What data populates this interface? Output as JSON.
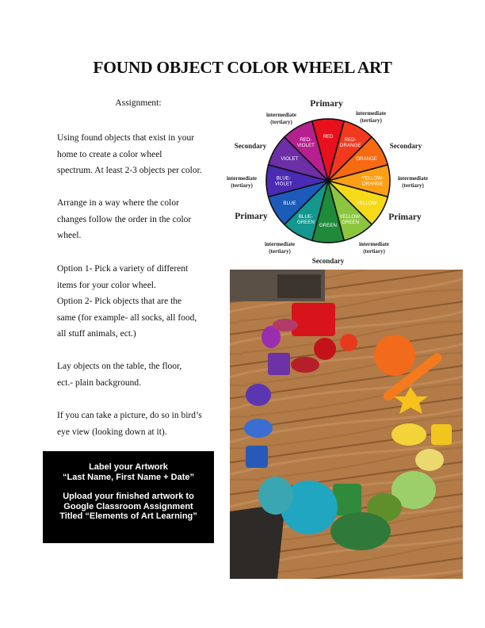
{
  "title": "FOUND OBJECT COLOR WHEEL ART",
  "assignment_heading": "Assignment:",
  "paragraphs": [
    [
      "Using found objects that exist in your",
      "home to create a color wheel",
      "spectrum. At least 2-3 objects per color."
    ],
    [
      "Arrange in a way where the color",
      "changes follow the order in the color",
      "wheel."
    ],
    [
      "Option 1- Pick a variety of different",
      "items for your color wheel.",
      "Option 2-  Pick objects that are the",
      "same (for example- all socks, all food,",
      "all stuff animals, ect.)"
    ],
    [
      "Lay objects on the table, the floor,",
      "ect.- plain background."
    ],
    [
      "If you can take a picture, do so in bird’s",
      "eye view (looking down at it)."
    ]
  ],
  "notice_box": {
    "line1": "Label your Artwork",
    "line2": "“Last Name, First Name + Date”",
    "line3": "Upload your finished artwork to",
    "line4": "Google Classroom Assignment",
    "line5": "Titled “Elements of Art Learning”"
  },
  "color_wheel": {
    "segments": [
      {
        "label": "RED",
        "color": "#e8101c"
      },
      {
        "label": "RED-\nORANGE",
        "color": "#f2391e"
      },
      {
        "label": "ORANGE",
        "color": "#f86a12"
      },
      {
        "label": "YELLOW-\nORANGE",
        "color": "#fb9f16"
      },
      {
        "label": "YELLOW",
        "color": "#f6da18"
      },
      {
        "label": "YELLOW-\nGREEN",
        "color": "#8cc63f"
      },
      {
        "label": "GREEN",
        "color": "#1e8a3a"
      },
      {
        "label": "BLUE-\nGREEN",
        "color": "#13978e"
      },
      {
        "label": "BLUE",
        "color": "#1c5bb9"
      },
      {
        "label": "BLUE-\nVIOLET",
        "color": "#4a2bb3"
      },
      {
        "label": "VIOLET",
        "color": "#6c2fa7"
      },
      {
        "label": "RED-\nVIOLET",
        "color": "#b5208e"
      }
    ],
    "primary": "Primary",
    "secondary": "Secondary",
    "intermediate": "intermediate",
    "tertiary": "(tertiary)"
  },
  "photo": {
    "floor_color": "#b07a45"
  }
}
